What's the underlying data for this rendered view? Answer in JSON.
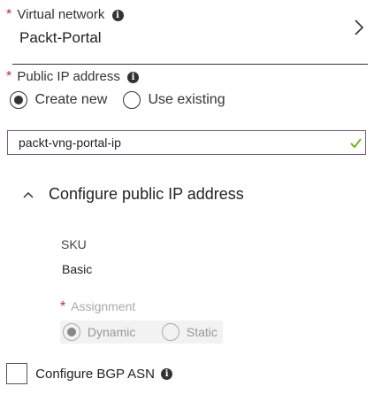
{
  "vnet": {
    "label": "Virtual network",
    "required_mark": "*",
    "value": "Packt-Portal"
  },
  "public_ip": {
    "label": "Public IP address",
    "required_mark": "*",
    "options": {
      "create_new": "Create new",
      "use_existing": "Use existing"
    },
    "selected": "create_new",
    "input_value": "packt-vng-portal-ip",
    "valid": true
  },
  "configure_section": {
    "title": "Configure public IP address",
    "expanded": true,
    "sku_label": "SKU",
    "sku_value": "Basic",
    "assignment_label": "Assignment",
    "assignment_required_mark": "*",
    "assignment_options": {
      "dynamic": "Dynamic",
      "static": "Static"
    },
    "assignment_selected": "dynamic",
    "assignment_disabled": true
  },
  "bgp": {
    "label": "Configure BGP ASN",
    "checked": false
  },
  "colors": {
    "required": "#c4262e",
    "valid_check": "#5db300",
    "input_border": "#7a5c8a",
    "disabled_bg": "#f2f2f2"
  }
}
